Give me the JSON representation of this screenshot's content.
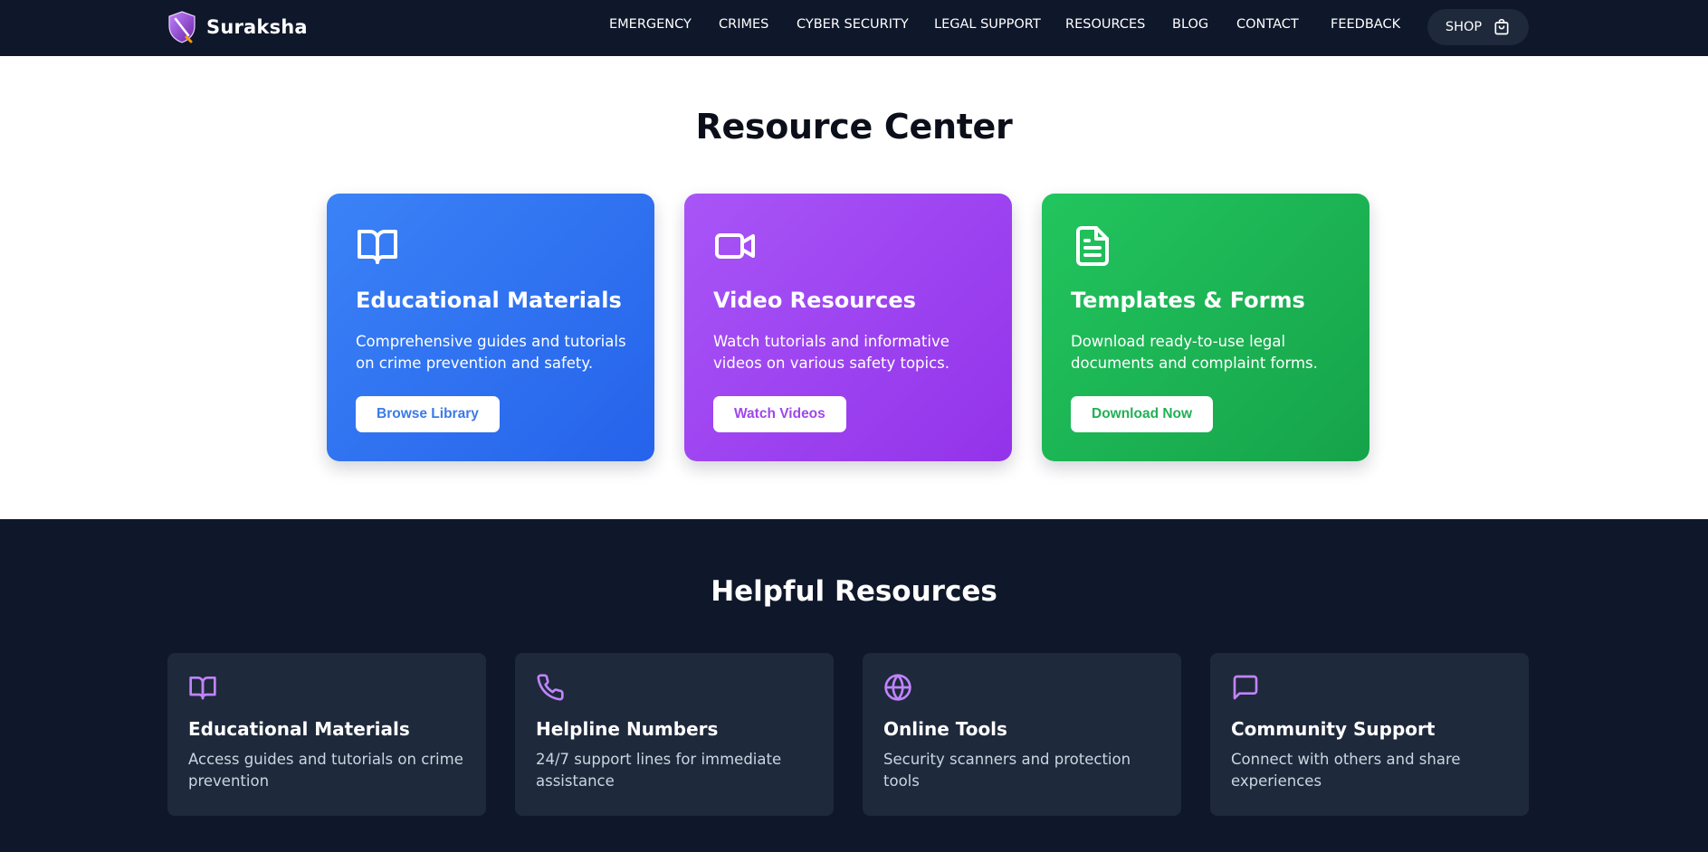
{
  "header": {
    "brand_name": "Suraksha",
    "nav": [
      {
        "label": "EMERGENCY"
      },
      {
        "label": "CRIMES"
      },
      {
        "label": "CYBER SECURITY"
      },
      {
        "label": "LEGAL SUPPORT"
      },
      {
        "label": "RESOURCES"
      },
      {
        "label": "BLOG"
      },
      {
        "label": "CONTACT"
      },
      {
        "label": "FEEDBACK"
      }
    ],
    "shop_label": "SHOP"
  },
  "resource_center": {
    "title": "Resource Center",
    "cards": [
      {
        "icon": "book-open-icon",
        "title": "Educational Materials",
        "description": "Comprehensive guides and tutorials on crime prevention and safety.",
        "button": "Browse Library",
        "color": "#3b82f6"
      },
      {
        "icon": "video-icon",
        "title": "Video Resources",
        "description": "Watch tutorials and informative videos on various safety topics.",
        "button": "Watch Videos",
        "color": "#a855f7"
      },
      {
        "icon": "file-text-icon",
        "title": "Templates & Forms",
        "description": "Download ready-to-use legal documents and complaint forms.",
        "button": "Download Now",
        "color": "#22c55e"
      }
    ]
  },
  "helpful_resources": {
    "title": "Helpful Resources",
    "accent_color": "#c084fc",
    "cards": [
      {
        "icon": "book-open-icon",
        "title": "Educational Materials",
        "description": "Access guides and tutorials on crime prevention"
      },
      {
        "icon": "phone-icon",
        "title": "Helpline Numbers",
        "description": "24/7 support lines for immediate assistance"
      },
      {
        "icon": "globe-icon",
        "title": "Online Tools",
        "description": "Security scanners and protection tools"
      },
      {
        "icon": "message-square-icon",
        "title": "Community Support",
        "description": "Connect with others and share experiences"
      }
    ]
  },
  "colors": {
    "navbar_bg": "#0f172a",
    "section_bg": "#0f172a",
    "card_bg": "#1e293b"
  }
}
